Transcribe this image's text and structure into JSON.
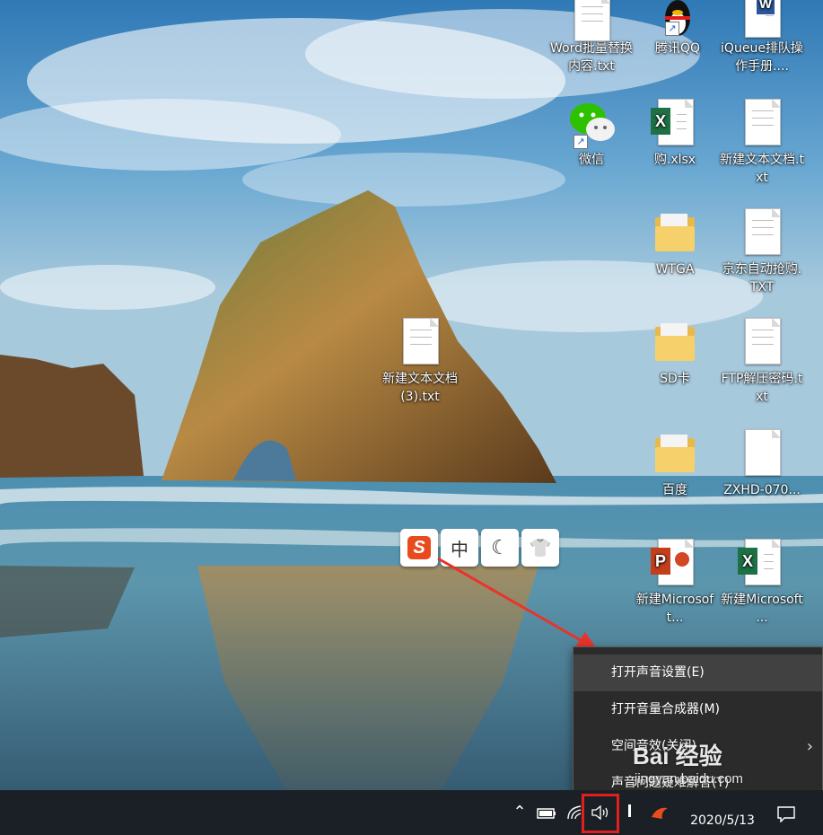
{
  "desktop": {
    "icons": [
      {
        "name": "word-batch-replace-txt",
        "label": "Word批量替换内容.txt",
        "icon": "text-document-icon"
      },
      {
        "name": "tencent-qq",
        "label": "腾讯QQ",
        "icon": "qq-penguin-icon"
      },
      {
        "name": "ique-manual",
        "label": "iQueue排队操作手册....",
        "icon": "word-document-icon"
      },
      {
        "name": "wechat",
        "label": "微信",
        "icon": "wechat-icon"
      },
      {
        "name": "gou-xlsx",
        "label": "购.xlsx",
        "icon": "excel-icon"
      },
      {
        "name": "new-text-doc",
        "label": "新建文本文档.txt",
        "icon": "text-document-icon"
      },
      {
        "name": "wtga",
        "label": "WTGA",
        "icon": "folder-icon"
      },
      {
        "name": "jd-auto-buy",
        "label": "京东自动抢购.TXT",
        "icon": "text-document-icon"
      },
      {
        "name": "new-text-doc-3",
        "label": "新建文本文档(3).txt",
        "icon": "text-document-icon"
      },
      {
        "name": "sd-card",
        "label": "SD卡",
        "icon": "folder-icon"
      },
      {
        "name": "ftp-password",
        "label": "FTP解压密码.txt",
        "icon": "text-document-icon"
      },
      {
        "name": "baidu",
        "label": "百度",
        "icon": "folder-icon"
      },
      {
        "name": "zxhd",
        "label": "ZXHD-070...",
        "icon": "blank-file-icon"
      },
      {
        "name": "new-ppt",
        "label": "新建Microsoft...",
        "icon": "powerpoint-icon"
      },
      {
        "name": "new-excel",
        "label": "新建Microsoft ...",
        "icon": "excel-icon"
      }
    ]
  },
  "ime_toolbar": {
    "logo": "S",
    "mode": "中",
    "moon": "☾",
    "skin": "👕"
  },
  "context_menu": {
    "items": [
      {
        "label": "打开声音设置(E)"
      },
      {
        "label": "打开音量合成器(M)"
      },
      {
        "label": "空间音效(关闭)",
        "submenu": "›"
      },
      {
        "label": "声音问题疑难解答(T)"
      }
    ]
  },
  "taskbar": {
    "tray_chevron": "⌃",
    "date": "2020/5/13"
  },
  "watermark": {
    "brand": "Bai 经验",
    "url": "jingyan.baidu.com"
  },
  "colors": {
    "highlight_red": "#e0201b",
    "menu_bg": "#2b2b2b",
    "taskbar_bg": "#1b2026"
  }
}
